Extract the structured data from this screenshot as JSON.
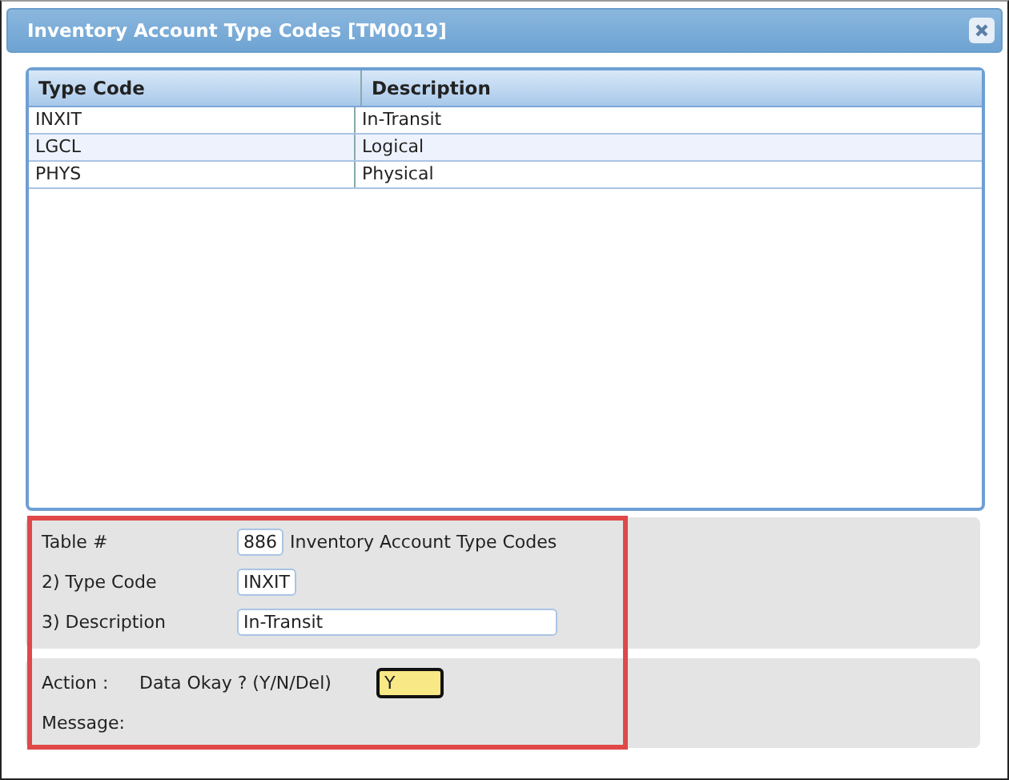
{
  "window": {
    "title": "Inventory Account Type Codes [TM0019]"
  },
  "table": {
    "columns": [
      "Type Code",
      "Description"
    ],
    "rows": [
      {
        "cells": [
          "INXIT",
          "In-Transit"
        ]
      },
      {
        "cells": [
          "LGCL",
          "Logical"
        ]
      },
      {
        "cells": [
          "PHYS",
          "Physical"
        ]
      }
    ]
  },
  "form": {
    "table_label": "Table #",
    "table_number": "886",
    "table_name": "Inventory Account Type Codes",
    "fields": [
      {
        "label": "2) Type Code",
        "value": "INXIT",
        "kind": "short"
      },
      {
        "label": "3) Description",
        "value": "In-Transit",
        "kind": "long"
      }
    ]
  },
  "action": {
    "label": "Action :",
    "prompt": "Data Okay ? (Y/N/Del)",
    "value": "Y",
    "message_label": "Message:"
  }
}
